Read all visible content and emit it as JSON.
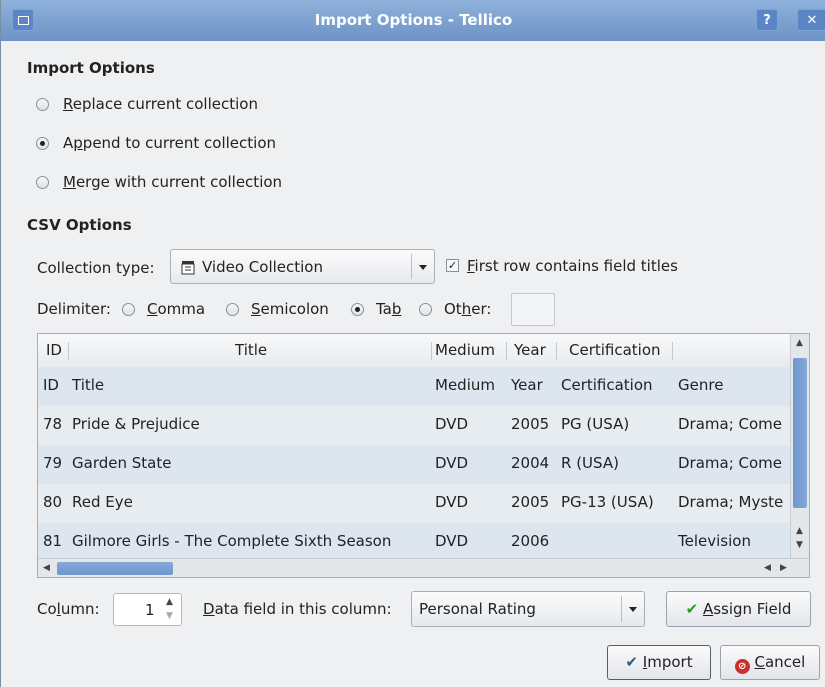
{
  "window": {
    "title": "Import Options - Tellico",
    "help_label": "?",
    "close_label": "✕"
  },
  "import_options": {
    "heading": "Import Options",
    "replace": {
      "mnemonic": "R",
      "rest": "eplace current collection"
    },
    "append": {
      "pre": "A",
      "mnemonic": "p",
      "rest": "pend to current collection"
    },
    "merge": {
      "mnemonic": "M",
      "rest": "erge with current collection"
    },
    "selected": "append"
  },
  "csv_options": {
    "heading": "CSV Options",
    "collection_type_label": "Collection type:",
    "collection_type_value": "Video Collection",
    "collection_type_icon": "film-clapper-icon",
    "first_row": {
      "mnemonic": "F",
      "rest": "irst row contains field titles",
      "checked": true
    },
    "delimiter_label": "Delimiter:",
    "comma": {
      "mnemonic": "C",
      "rest": "omma"
    },
    "semicolon": {
      "mnemonic": "S",
      "rest": "emicolon"
    },
    "tab": {
      "pre": "Ta",
      "mnemonic": "b"
    },
    "other": {
      "pre": "Ot",
      "mnemonic": "h",
      "rest": "er:"
    },
    "other_value": "",
    "selected_delimiter": "tab"
  },
  "table": {
    "headers": [
      "ID",
      "Title",
      "Medium",
      "Year",
      "Certification"
    ],
    "rows": [
      [
        "ID",
        "Title",
        "Medium",
        "Year",
        "Certification",
        "Genre"
      ],
      [
        "78",
        "Pride & Prejudice",
        "DVD",
        "2005",
        "PG (USA)",
        "Drama; Come"
      ],
      [
        "79",
        "Garden State",
        "DVD",
        "2004",
        "R (USA)",
        "Drama; Come"
      ],
      [
        "80",
        "Red Eye",
        "DVD",
        "2005",
        "PG-13 (USA)",
        "Drama; Myste"
      ],
      [
        "81",
        "Gilmore Girls - The Complete Sixth Season",
        "DVD",
        "2006",
        "",
        "Television"
      ]
    ]
  },
  "column": {
    "label_pre": "Co",
    "label_mnemonic": "l",
    "label_rest": "umn:",
    "value": "1"
  },
  "data_field": {
    "label_mnemonic": "D",
    "label_rest": "ata field in this column:",
    "value": "Personal Rating"
  },
  "buttons": {
    "assign": {
      "mnemonic": "A",
      "rest": "ssign Field"
    },
    "import": {
      "mnemonic": "I",
      "rest": "mport"
    },
    "cancel": {
      "mnemonic": "C",
      "rest": "ancel"
    }
  },
  "colors": {
    "titlebar": "#7a9fd0",
    "selection_blue": "#6f96cf",
    "row_alt": "#e7ecf1"
  }
}
